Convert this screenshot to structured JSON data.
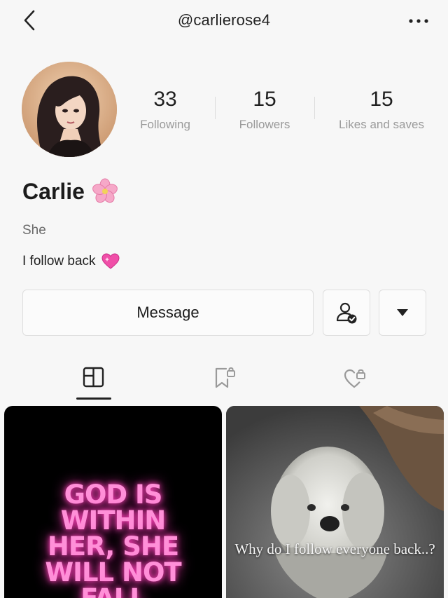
{
  "header": {
    "username": "@carlierose4"
  },
  "profile": {
    "display_name": "Carlie",
    "display_name_emoji": "cherry-blossom",
    "bio_line_1": "She",
    "bio_line_2": "I follow back",
    "bio_line_2_emoji": "sparkling-heart"
  },
  "stats": [
    {
      "value": "33",
      "label": "Following"
    },
    {
      "value": "15",
      "label": "Followers"
    },
    {
      "value": "15",
      "label": "Likes and saves"
    }
  ],
  "actions": {
    "message_label": "Message"
  },
  "tabs": [
    {
      "icon": "grid-layout-icon",
      "active": true
    },
    {
      "icon": "bookmark-lock-icon",
      "active": false
    },
    {
      "icon": "heart-lock-icon",
      "active": false
    }
  ],
  "posts": [
    {
      "text": "GOD IS\nWITHIN\nHER, SHE\nWILL NOT\nFALL"
    },
    {
      "text": "Why do I follow everyone back..?"
    }
  ],
  "colors": {
    "neon_pink": "#ff8fd8",
    "background": "#f7f7f7"
  }
}
